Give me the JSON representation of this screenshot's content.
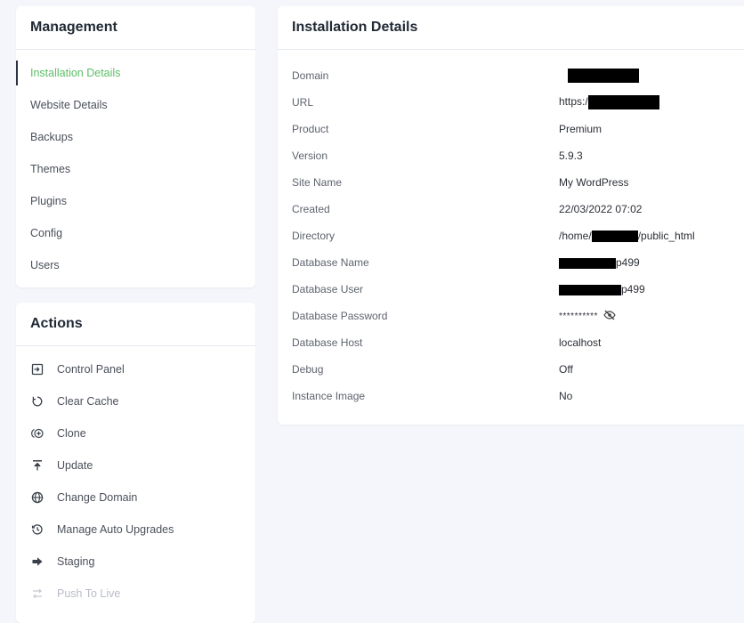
{
  "management": {
    "title": "Management",
    "items": [
      {
        "label": "Installation Details",
        "active": true
      },
      {
        "label": "Website Details"
      },
      {
        "label": "Backups"
      },
      {
        "label": "Themes"
      },
      {
        "label": "Plugins"
      },
      {
        "label": "Config"
      },
      {
        "label": "Users"
      }
    ]
  },
  "actions": {
    "title": "Actions",
    "items": [
      {
        "label": "Control Panel",
        "icon": "control-panel-icon"
      },
      {
        "label": "Clear Cache",
        "icon": "clear-cache-icon"
      },
      {
        "label": "Clone",
        "icon": "clone-icon"
      },
      {
        "label": "Update",
        "icon": "update-icon"
      },
      {
        "label": "Change Domain",
        "icon": "globe-icon"
      },
      {
        "label": "Manage Auto Upgrades",
        "icon": "history-icon"
      },
      {
        "label": "Staging",
        "icon": "arrow-right-icon"
      },
      {
        "label": "Push To Live",
        "icon": "push-to-live-icon",
        "disabled": true
      }
    ]
  },
  "details": {
    "title": "Installation Details",
    "rows": [
      {
        "key": "Domain",
        "value": "",
        "prefix": "",
        "suffix": ""
      },
      {
        "key": "URL",
        "value": "",
        "prefix": "https:/",
        "suffix": ""
      },
      {
        "key": "Product",
        "value": "Premium"
      },
      {
        "key": "Version",
        "value": "5.9.3"
      },
      {
        "key": "Site Name",
        "value": "My WordPress"
      },
      {
        "key": "Created",
        "value": "22/03/2022 07:02"
      },
      {
        "key": "Directory",
        "value": "",
        "prefix": "/home/",
        "suffix": "/public_html"
      },
      {
        "key": "Database Name",
        "value": "",
        "prefix": "",
        "suffix": "p499"
      },
      {
        "key": "Database User",
        "value": "",
        "prefix": "",
        "suffix": "p499"
      },
      {
        "key": "Database Password",
        "value": "**********"
      },
      {
        "key": "Database Host",
        "value": "localhost"
      },
      {
        "key": "Debug",
        "value": "Off"
      },
      {
        "key": "Instance Image",
        "value": "No"
      }
    ]
  },
  "colors": {
    "accent": "#5cbf66",
    "page_bg": "#f4f6fb",
    "card_bg": "#ffffff"
  }
}
